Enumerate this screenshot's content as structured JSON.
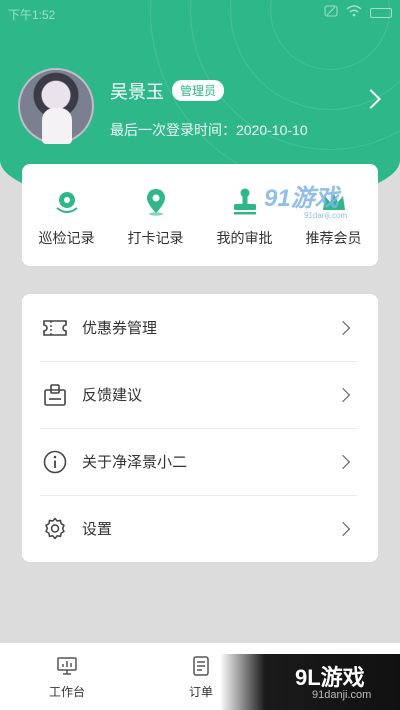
{
  "status_bar": {
    "time": "下午1:52"
  },
  "profile": {
    "name": "吴景玉",
    "role_badge": "管理员",
    "last_login": "最后一次登录时间：2020-10-10"
  },
  "quick_actions": [
    {
      "label": "巡检记录",
      "icon": "inspection-icon"
    },
    {
      "label": "打卡记录",
      "icon": "location-pin-icon"
    },
    {
      "label": "我的审批",
      "icon": "stamp-icon"
    },
    {
      "label": "推荐会员",
      "icon": "crown-icon"
    }
  ],
  "menu": [
    {
      "label": "优惠券管理",
      "icon": "coupon-icon"
    },
    {
      "label": "反馈建议",
      "icon": "feedback-icon"
    },
    {
      "label": "关于净泽景小二",
      "icon": "info-icon"
    },
    {
      "label": "设置",
      "icon": "gear-icon"
    }
  ],
  "tabs": [
    {
      "label": "工作台",
      "icon": "monitor-icon"
    },
    {
      "label": "订单",
      "icon": "order-icon"
    }
  ],
  "watermark": {
    "logo_text": "91游戏",
    "url": "91danji.com"
  },
  "banner": {
    "logo_text": "9L游戏",
    "url": "91danji.com"
  },
  "colors": {
    "accent": "#2eb88a",
    "page_bg": "#dcdcdc",
    "card_bg": "#ffffff"
  }
}
